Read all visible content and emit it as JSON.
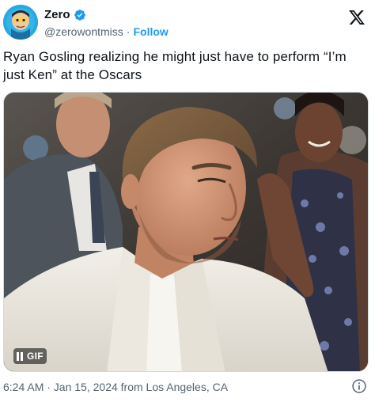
{
  "author": {
    "display_name": "Zero",
    "handle": "@zerowontmiss",
    "separator": "·",
    "follow_label": "Follow",
    "verified_color": "#1d9bf0"
  },
  "tweet": {
    "text_line1": "Ryan Gosling realizing he might just have to perform “I’m",
    "text_line2": "just Ken” at the Oscars"
  },
  "media": {
    "type": "gif",
    "gif_label": "GIF"
  },
  "footer": {
    "timestamp": "6:24 AM · Jan 15, 2024 from Los Angeles, CA"
  },
  "icons": {
    "brand": "x-logo-icon",
    "info": "info-icon",
    "verified": "verified-badge-icon",
    "pause": "pause-icon"
  },
  "colors": {
    "accent": "#1d9bf0",
    "text": "#0f1419",
    "secondary": "#536471"
  }
}
